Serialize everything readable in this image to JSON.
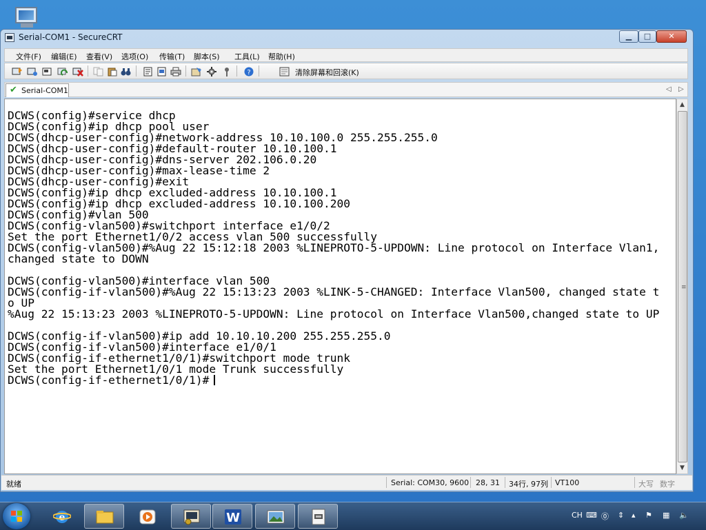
{
  "desktop": {
    "icon_name": "computer-icon"
  },
  "window": {
    "title": "Serial-COM1 - SecureCRT",
    "controls": {
      "minimize": "▁",
      "maximize": "□",
      "close": "✕"
    }
  },
  "menu": {
    "file": "文件(F)",
    "edit": "编辑(E)",
    "view": "查看(V)",
    "options": "选项(O)",
    "transfer": "传输(T)",
    "script": "脚本(S)",
    "tools": "工具(L)",
    "help": "帮助(H)"
  },
  "toolbar": {
    "clear_label": "清除屏幕和回滚(K)"
  },
  "tab": {
    "label": "Serial-COM1",
    "prev": "◁",
    "next": "▷"
  },
  "terminal": {
    "lines": [
      "DCWS(config)#service dhcp",
      "DCWS(config)#ip dhcp pool user",
      "DCWS(dhcp-user-config)#network-address 10.10.100.0 255.255.255.0",
      "DCWS(dhcp-user-config)#default-router 10.10.100.1",
      "DCWS(dhcp-user-config)#dns-server 202.106.0.20",
      "DCWS(dhcp-user-config)#max-lease-time 2",
      "DCWS(dhcp-user-config)#exit",
      "DCWS(config)#ip dhcp excluded-address 10.10.100.1",
      "DCWS(config)#ip dhcp excluded-address 10.10.100.200",
      "DCWS(config)#vlan 500",
      "DCWS(config-vlan500)#switchport interface e1/0/2",
      "Set the port Ethernet1/0/2 access vlan 500 successfully",
      "DCWS(config-vlan500)#%Aug 22 15:12:18 2003 %LINEPROTO-5-UPDOWN: Line protocol on Interface Vlan1,",
      "changed state to DOWN",
      "",
      "DCWS(config-vlan500)#interface vlan 500",
      "DCWS(config-if-vlan500)#%Aug 22 15:13:23 2003 %LINK-5-CHANGED: Interface Vlan500, changed state t",
      "o UP",
      "%Aug 22 15:13:23 2003 %LINEPROTO-5-UPDOWN: Line protocol on Interface Vlan500,changed state to UP",
      "",
      "DCWS(config-if-vlan500)#ip add 10.10.10.200 255.255.255.0",
      "DCWS(config-if-vlan500)#interface e1/0/1",
      "DCWS(config-if-ethernet1/0/1)#switchport mode trunk",
      "Set the port Ethernet1/0/1 mode Trunk successfully",
      "DCWS(config-if-ethernet1/0/1)#"
    ]
  },
  "status": {
    "ready": "就绪",
    "connection": "Serial: COM30, 9600",
    "cursor_pos": "28,  31",
    "size": "34行, 97列",
    "emulation": "VT100",
    "caps": "大写",
    "num": "数字"
  },
  "taskbar": {
    "tray_lang": "CH",
    "tray_icons": [
      "keyboard-icon",
      "help-icon",
      "flag-icon",
      "network-icon",
      "volume-icon"
    ]
  }
}
